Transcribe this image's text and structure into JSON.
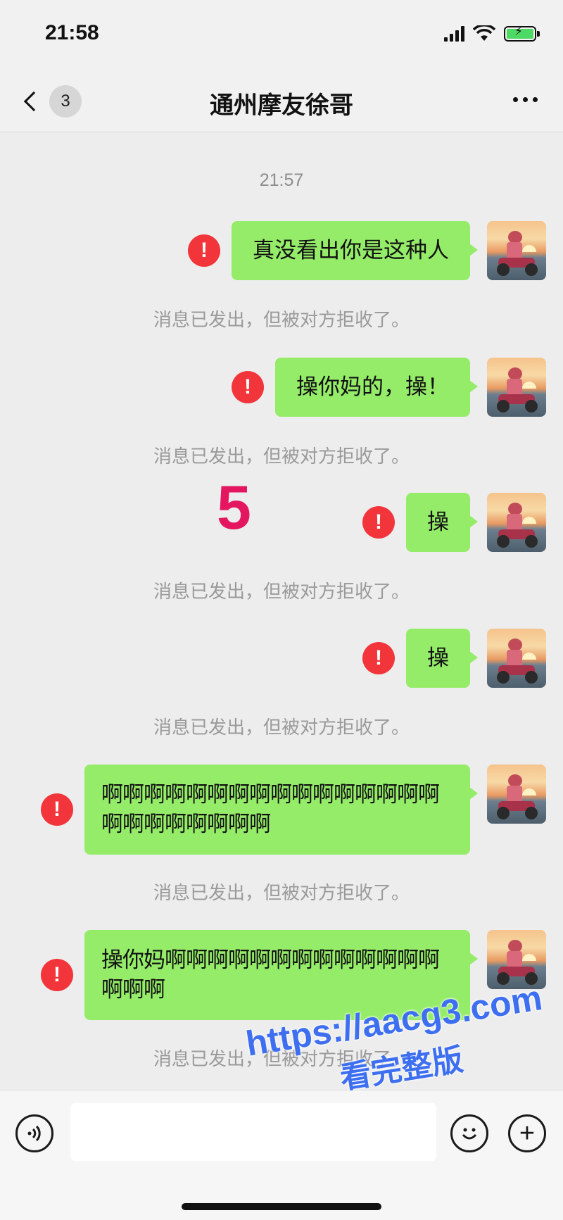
{
  "status_bar": {
    "time": "21:58"
  },
  "nav": {
    "unread_count": "3",
    "title": "通州摩友徐哥"
  },
  "chat": {
    "timestamp": "21:57",
    "error_mark": "!",
    "rejected_note": "消息已发出，但被对方拒收了。",
    "messages": [
      {
        "text": "真没看出你是这种人"
      },
      {
        "text": "操你妈的，操！"
      },
      {
        "text": "操"
      },
      {
        "text": "操"
      },
      {
        "text": "啊啊啊啊啊啊啊啊啊啊啊啊啊啊啊啊啊啊啊啊啊啊啊啊"
      },
      {
        "text": "操你妈啊啊啊啊啊啊啊啊啊啊啊啊啊啊啊啊"
      }
    ]
  },
  "overlay": {
    "number": "5",
    "watermark_url": "https://aacg3.com",
    "watermark_text": "看完整版"
  },
  "input": {
    "value": ""
  },
  "colors": {
    "bubble": "#95ec69",
    "error": "#f2353a",
    "background": "#ededed",
    "overlay_number": "#e3165f",
    "watermark": "#3d6ff0"
  },
  "icons": [
    "signal-icon",
    "wifi-icon",
    "battery-charging-icon",
    "back-chevron-icon",
    "more-icon",
    "error-icon",
    "voice-icon",
    "emoji-icon",
    "plus-icon"
  ]
}
